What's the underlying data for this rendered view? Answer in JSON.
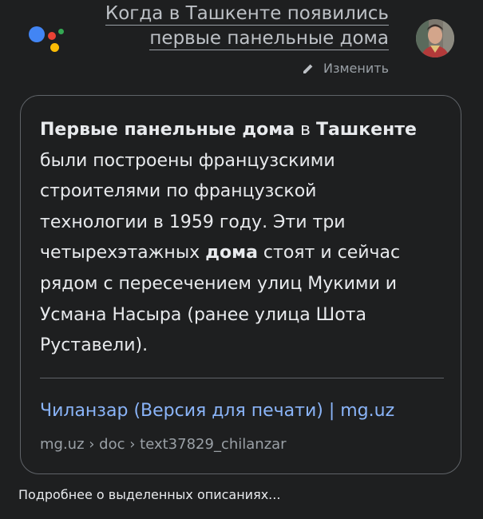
{
  "query": {
    "line1": "Когда в Ташкенте появились",
    "line2": "первые панельные дома",
    "edit_label": "Изменить"
  },
  "answer": {
    "segments": [
      {
        "text": "Первые панельные дома",
        "bold": true
      },
      {
        "text": " в ",
        "bold": false
      },
      {
        "text": "Ташкенте",
        "bold": true
      },
      {
        "text": " были построены французскими строителями по французской технологии в 1959 году. Эти три четырехэтажных ",
        "bold": false
      },
      {
        "text": "дома",
        "bold": true
      },
      {
        "text": " стоят и сейчас рядом с пересечением улиц Мукими и Усмана Насыра (ранее улица Шота Руставели).",
        "bold": false
      }
    ]
  },
  "source": {
    "title": "Чиланзар (Версия для печати) | mg.uz",
    "breadcrumb": "mg.uz › doc › text37829_chilanzar"
  },
  "footer": {
    "more_link": "Подробнее о выделенных описаниях..."
  },
  "icons": {
    "logo": "google-assistant-dots-icon",
    "edit": "pencil-icon",
    "avatar": "user-avatar"
  },
  "colors": {
    "background": "#1e1f20",
    "link": "#8ab4f8",
    "border": "#5f6368"
  }
}
